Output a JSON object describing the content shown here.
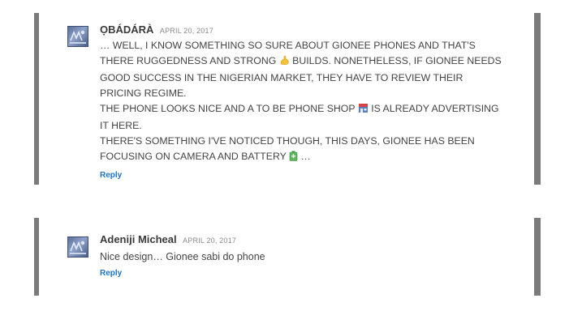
{
  "comments": [
    {
      "author": "ỌBÁDÁRÀ",
      "date": "APRIL 20, 2017",
      "lines": {
        "l1": "… WELL, I KNOW SOMETHING SO SURE ABOUT GIONEE PHONES AND THAT'S",
        "l2a": "THERE RUGGEDNESS AND STRONG",
        "l2b": "BUILDS. NONETHELESS, IF GIONEE NEEDS",
        "l3": "GOOD SUCCESS IN THE NIGERIAN MARKET, THEY HAVE TO REVIEW THEIR",
        "l4": "PRICING REGIME.",
        "l5a": "THE PHONE LOOKS NICE AND A TO BE PHONE SHOP",
        "l5b": "IS ALREADY ADVERTISING",
        "l6": "IT HERE.",
        "l7": "THERE'S SOMETHING I'VE NOTICED THOUGH, THIS DAYS, GIONEE HAS BEEN",
        "l8a": "FOCUSING ON CAMERA AND BATTERY",
        "l8b": "…"
      },
      "emojis": [
        "flexed-biceps-icon",
        "shop-icon",
        "battery-icon"
      ],
      "reply_label": "Reply"
    },
    {
      "author": "Adeniji Micheal",
      "date": "APRIL 20, 2017",
      "text": "Nice design… Gionee sabi do phone",
      "reply_label": "Reply"
    }
  ],
  "colors": {
    "border": "#7b7b7b",
    "link": "#1e73be",
    "text": "#444444",
    "date": "#8a8a8a"
  }
}
